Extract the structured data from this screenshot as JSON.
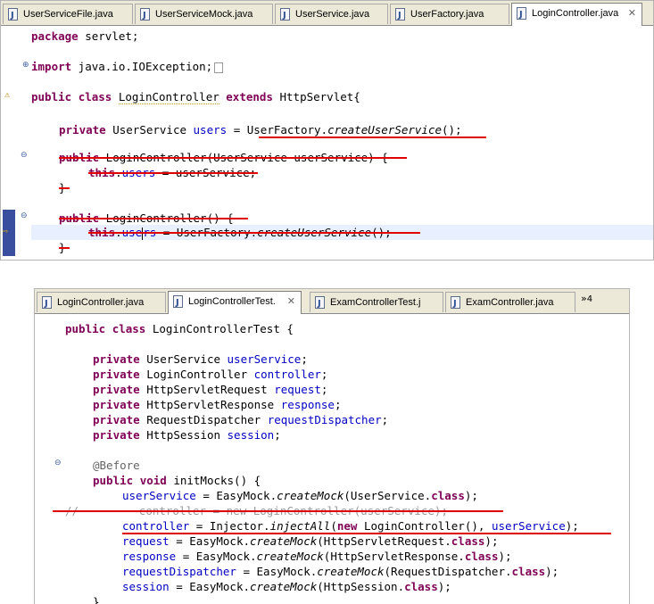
{
  "top_panel": {
    "tabs": [
      {
        "label": "UserServiceFile.java"
      },
      {
        "label": "UserServiceMock.java"
      },
      {
        "label": "UserService.java"
      },
      {
        "label": "UserFactory.java"
      },
      {
        "label": "LoginController.java",
        "active": true,
        "close": "✕"
      }
    ],
    "code": {
      "l1_kw": "package",
      "l1_rest": " servlet;",
      "l2_kw": "import",
      "l2_rest": " java.io.IOException;",
      "l3_kw1": "public",
      "l3_kw2": "class",
      "l3_name": "LoginController",
      "l3_kw3": "extends",
      "l3_rest": "HttpServlet{",
      "l4_kw": "private",
      "l4_type": " UserService ",
      "l4_fld": "users",
      "l4_eq": " = ",
      "l4_call": "UserFactory.",
      "l4_method": "createUserService",
      "l4_end": "();",
      "l5_kw": "public",
      "l5_rest": " LoginController(UserService userService) {",
      "l6_kw": "this",
      "l6_dot": ".",
      "l6_fld": "users",
      "l6_rest": " = userService;",
      "l7": "}",
      "l8_kw": "public",
      "l8_rest": " LoginController() {",
      "l9_kw": "this",
      "l9_dot": ".",
      "l9_fld_a": "use",
      "l9_fld_b": "rs",
      "l9_rest": " = UserFactory.",
      "l9_method": "createUserService",
      "l9_end": "();",
      "l10": "}"
    }
  },
  "bottom_panel": {
    "tabs": [
      {
        "label": "LoginController.java"
      },
      {
        "label": "LoginControllerTest.",
        "active": true,
        "close": "✕"
      },
      {
        "label": "ExamControllerTest.j"
      },
      {
        "label": "ExamController.java"
      }
    ],
    "overflow_label": "»",
    "overflow_count": "4",
    "code": {
      "c1_kw1": "public",
      "c1_kw2": "class",
      "c1_rest": " LoginControllerTest {",
      "fields": [
        {
          "kw": "private",
          "type": " UserService ",
          "name": "userService",
          "end": ";"
        },
        {
          "kw": "private",
          "type": " LoginController ",
          "name": "controller",
          "end": ";"
        },
        {
          "kw": "private",
          "type": " HttpServletRequest ",
          "name": "request",
          "end": ";"
        },
        {
          "kw": "private",
          "type": " HttpServletResponse ",
          "name": "response",
          "end": ";"
        },
        {
          "kw": "private",
          "type": " RequestDispatcher ",
          "name": "requestDispatcher",
          "end": ";"
        },
        {
          "kw": "private",
          "type": " HttpSession ",
          "name": "session",
          "end": ";"
        }
      ],
      "ann": "@Before",
      "m_kw1": "public",
      "m_kw2": "void",
      "m_rest": " initMocks() {",
      "s1_fld": "userService",
      "s1_a": " = EasyMock.",
      "s1_m": "createMock",
      "s1_b": "(UserService.",
      "s1_kw": "class",
      "s1_end": ");",
      "s2_cmt": "//",
      "s2_fld": "controller",
      "s2_rest": " = new LoginController(userService);",
      "s3_fld": "controller",
      "s3_a": " = Injector.",
      "s3_m": "injectAll",
      "s3_b": "(",
      "s3_kw": "new",
      "s3_c": " LoginController(), ",
      "s3_fld2": "userService",
      "s3_end": ");",
      "s4_fld": "request",
      "s4_a": " = EasyMock.",
      "s4_m": "createMock",
      "s4_b": "(HttpServletRequest.",
      "s4_kw": "class",
      "s4_end": ");",
      "s5_fld": "response",
      "s5_a": " = EasyMock.",
      "s5_m": "createMock",
      "s5_b": "(HttpServletResponse.",
      "s5_kw": "class",
      "s5_end": ");",
      "s6_fld": "requestDispatcher",
      "s6_a": " = EasyMock.",
      "s6_m": "createMock",
      "s6_b": "(RequestDispatcher.",
      "s6_kw": "class",
      "s6_end": ");",
      "s7_fld": "session",
      "s7_a": " = EasyMock.",
      "s7_m": "createMock",
      "s7_b": "(HttpSession.",
      "s7_kw": "class",
      "s7_end": ");",
      "s8": "}"
    }
  },
  "colors": {
    "keyword": "#7f0055",
    "field": "#0000c0",
    "annotation": "#646464",
    "strike": "#e00000",
    "tabbar": "#ece9d8"
  }
}
